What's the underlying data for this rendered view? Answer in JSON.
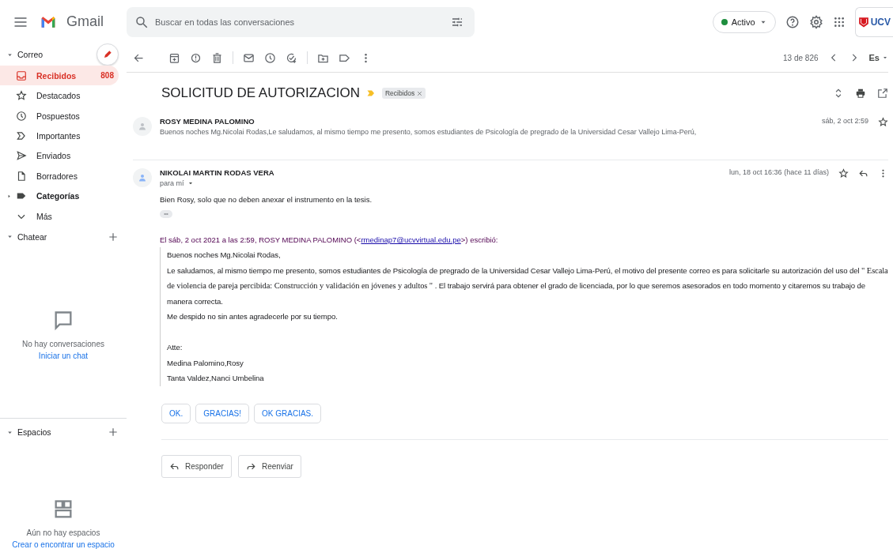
{
  "header": {
    "app_name": "Gmail",
    "search": {
      "placeholder": "Buscar en todas las conversaciones"
    },
    "status": {
      "label": "Activo",
      "color": "#1e8e3e"
    },
    "org_logo": {
      "text": "UCV"
    }
  },
  "sidebar": {
    "mail_section": {
      "title": "Correo",
      "expanded": true
    },
    "items": [
      {
        "label": "Recibidos",
        "count": "808",
        "selected": true,
        "bold": true
      },
      {
        "label": "Destacados",
        "selected": false,
        "bold": false
      },
      {
        "label": "Pospuestos",
        "selected": false,
        "bold": false
      },
      {
        "label": "Importantes",
        "selected": false,
        "bold": false
      },
      {
        "label": "Enviados",
        "selected": false,
        "bold": false
      },
      {
        "label": "Borradores",
        "selected": false,
        "bold": false
      },
      {
        "label": "Categorías",
        "selected": false,
        "bold": true,
        "expandable": true
      },
      {
        "label": "Más",
        "selected": false,
        "bold": false
      }
    ],
    "chat": {
      "title": "Chatear",
      "expanded": true,
      "empty_text": "No hay conversaciones",
      "link": "Iniciar un chat"
    },
    "spaces": {
      "title": "Espacios",
      "expanded": true,
      "empty_text": "Aún no hay espacios",
      "link": "Crear o encontrar un espacio"
    }
  },
  "toolbar": {
    "position": "13 de 826",
    "language": "Es"
  },
  "thread": {
    "subject": "SOLICITUD DE AUTORIZACION",
    "label": "Recibidos",
    "messages": [
      {
        "kind": "collapsed",
        "sender": "ROSY MEDINA PALOMINO",
        "snippet": "Buenos noches Mg.Nicolai Rodas,Le saludamos, al mismo tiempo me presento, somos estudiantes de Psicología de pregrado de la Universidad Cesar Vallejo Lima-Perú,",
        "date": "sáb, 2 oct 2:59",
        "starred": false
      },
      {
        "kind": "expanded",
        "sender": "NIKOLAI MARTIN RODAS VERA",
        "recipient": "para mí",
        "date": "lun, 18 oct 16:36 (hace 11 días)",
        "starred": false,
        "body": "Bien Rosy, solo que no deben anexar el instrumento en la tesis.",
        "quote": {
          "attribution_before": "El sáb, 2 oct 2021 a las 2:59, ROSY MEDINA PALOMINO (<",
          "email": "rmedinap7@ucvvirtual.edu.pe",
          "attribution_after": ">) escribió:",
          "paragraphs": [
            {
              "kind": "text",
              "segments": [
                {
                  "kind": "plain",
                  "text": "Buenos noches Mg.Nicolai Rodas,"
                }
              ]
            },
            {
              "kind": "text",
              "segments": [
                {
                  "kind": "plain",
                  "text": "Le saludamos, al mismo tiempo me presento, somos estudiantes de Psicología de pregrado de la Universidad Cesar Vallejo Lima-Perú, el motivo del presente correo es para solicitarle su autorización del uso del "
                },
                {
                  "kind": "serif",
                  "text": "\" Escala de violencia de pareja percibida: Construcción y validación en jóvenes y adultos \""
                },
                {
                  "kind": "plain",
                  "text": " . El trabajo servirá para obtener el grado de licenciada, por lo que seremos asesorados en todo momento y citaremos su trabajo de manera correcta."
                }
              ]
            },
            {
              "kind": "text",
              "segments": [
                {
                  "kind": "plain",
                  "text": "Me despido no sin antes agradecerle por su tiempo."
                }
              ]
            },
            {
              "kind": "spacer"
            },
            {
              "kind": "text",
              "segments": [
                {
                  "kind": "plain",
                  "text": "Atte:"
                }
              ]
            },
            {
              "kind": "text",
              "segments": [
                {
                  "kind": "plain",
                  "text": " Medina Palomino,Rosy"
                }
              ]
            },
            {
              "kind": "text",
              "segments": [
                {
                  "kind": "plain",
                  "text": " Tanta Valdez,Nanci Umbelina"
                }
              ]
            }
          ]
        }
      }
    ],
    "smart_replies": [
      "OK.",
      "GRACIAS!",
      "OK GRACIAS."
    ],
    "actions": [
      {
        "kind": "reply",
        "label": "Responder"
      },
      {
        "kind": "forward",
        "label": "Reenviar"
      }
    ]
  }
}
